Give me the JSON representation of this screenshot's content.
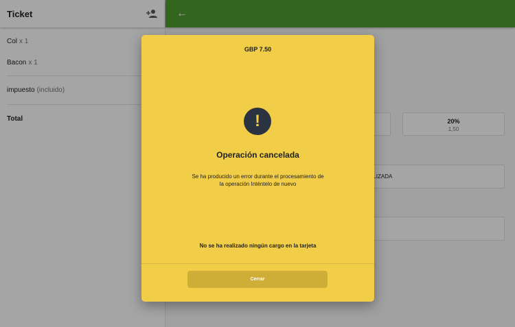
{
  "sidebar": {
    "title": "Ticket",
    "items": [
      {
        "name": "Col",
        "qty": "x 1"
      },
      {
        "name": "Bacon",
        "qty": "x 1"
      }
    ],
    "tax_label": "impuesto",
    "tax_note": "(incluido)",
    "total_label": "Total"
  },
  "main": {
    "tip_options": [
      {
        "percent": "",
        "amount": ""
      },
      {
        "percent": "20%",
        "amount": "1,50"
      }
    ],
    "status_box_text": "ALIZADA"
  },
  "dialog": {
    "amount": "GBP 7.50",
    "icon": "alert-exclamation-icon",
    "title": "Operación cancelada",
    "message": "Se ha producido un error durante el procesamiento de la operación Inténtelo de nuevo",
    "note": "No se ha realizado ningún cargo en la tarjeta",
    "close_label": "Cerrar"
  },
  "colors": {
    "topbar": "#4e9a2e",
    "dialog_bg": "#f1cd48",
    "close_button": "#cfae37",
    "alert_icon_bg": "#2b3240"
  }
}
